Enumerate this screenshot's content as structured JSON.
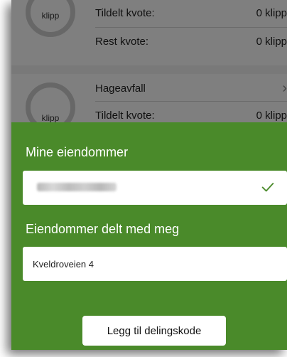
{
  "background": {
    "card1": {
      "gauge_label": "klipp",
      "rows": [
        {
          "label": "Tildelt kvote:",
          "value": "0 klipp"
        },
        {
          "label": "Rest kvote:",
          "value": "0 klipp"
        }
      ]
    },
    "card2": {
      "title": "Hageavfall",
      "gauge_label": "klipp",
      "rows": [
        {
          "label": "Tildelt kvote:",
          "value": "0 klipp"
        }
      ]
    }
  },
  "sheet": {
    "my_properties_title": "Mine eiendommer",
    "shared_properties_title": "Eiendommer delt med meg",
    "shared_properties": [
      {
        "address": "Kveldroveien 4"
      }
    ],
    "add_button_label": "Legg til delingskode"
  },
  "colors": {
    "sheet_green": "#4a8a2a",
    "check_green": "#4a8a2a"
  }
}
